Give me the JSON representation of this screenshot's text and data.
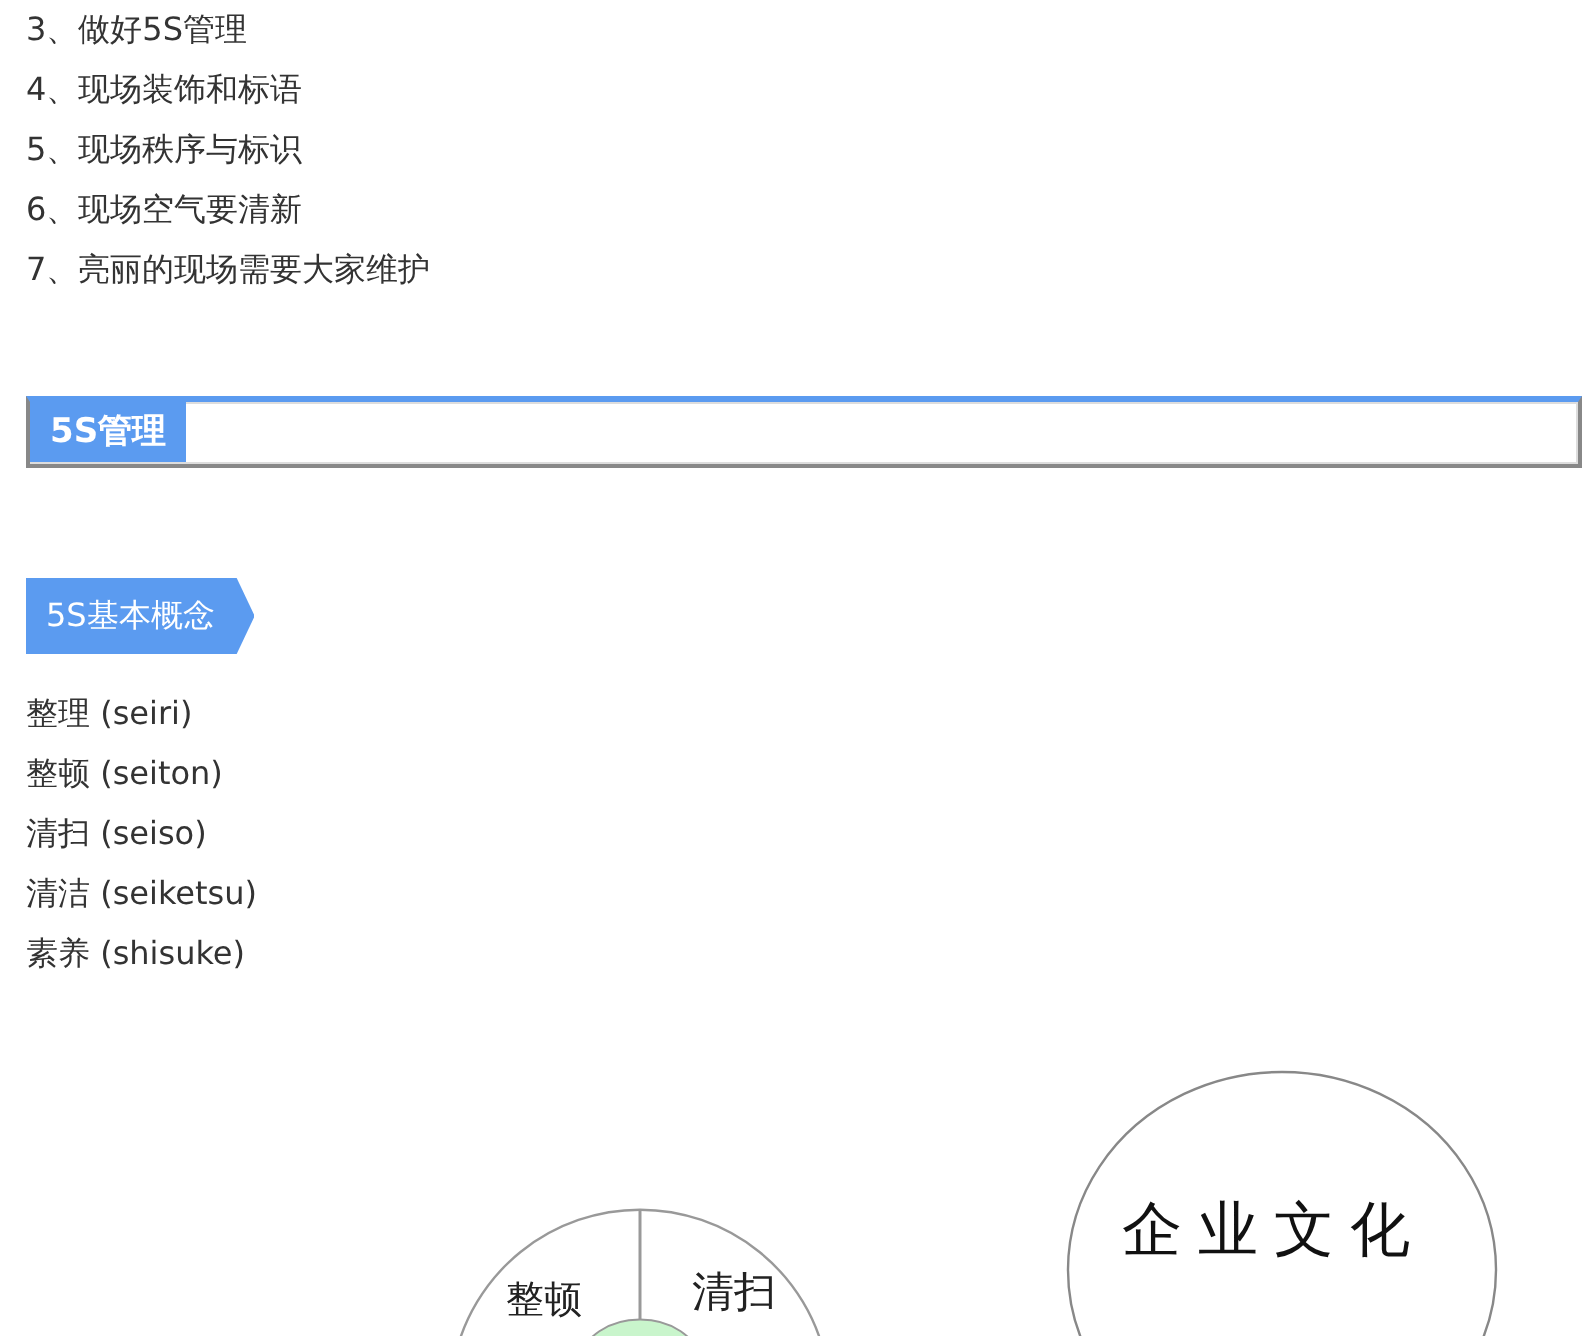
{
  "intro_list": [
    "3、做好5S管理",
    "4、现场装饰和标语",
    "5、现场秩序与标识",
    "6、现场空气要清新",
    "7、亮丽的现场需要大家维护"
  ],
  "section_bar": {
    "title": "5S管理"
  },
  "tag": {
    "title": "5S基本概念"
  },
  "terms": [
    "整理 (seiri)",
    "整顿 (seiton)",
    "清扫 (seiso)",
    "清洁 (seiketsu)",
    "素养 (shisuke)"
  ],
  "diagram": {
    "wheel_labels": [
      "整顿",
      "清扫"
    ],
    "culture_label": "企业文化"
  }
}
